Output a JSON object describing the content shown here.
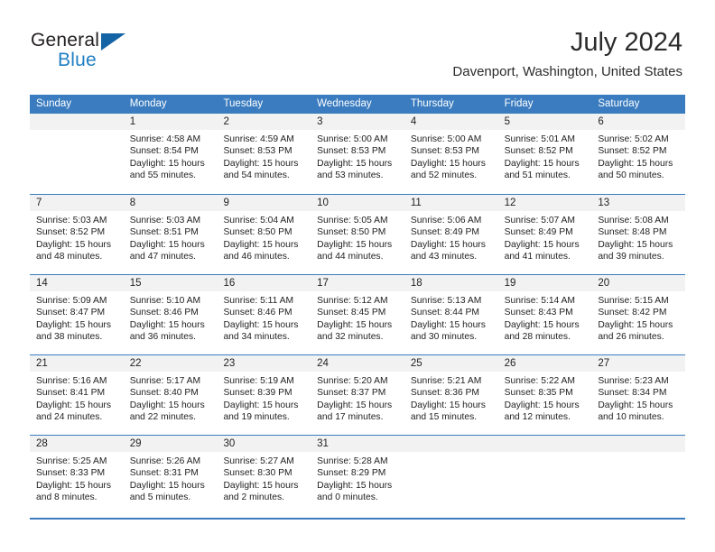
{
  "brand": {
    "name_top": "General",
    "name_bottom": "Blue",
    "triangle_icon": "triangle-icon",
    "color_dark": "#231f20",
    "color_blue": "#1f7fc4"
  },
  "header": {
    "title": "July 2024",
    "subtitle": "Davenport, Washington, United States"
  },
  "theme": {
    "header_blue": "#3a7cbf",
    "date_band_gray": "#f2f2f2",
    "text": "#222222"
  },
  "weekdays": [
    "Sunday",
    "Monday",
    "Tuesday",
    "Wednesday",
    "Thursday",
    "Friday",
    "Saturday"
  ],
  "weeks": [
    [
      {
        "date": "",
        "sunrise": "",
        "sunset": "",
        "daylight_line1": "",
        "daylight_line2": ""
      },
      {
        "date": "1",
        "sunrise": "Sunrise: 4:58 AM",
        "sunset": "Sunset: 8:54 PM",
        "daylight_line1": "Daylight: 15 hours",
        "daylight_line2": "and 55 minutes."
      },
      {
        "date": "2",
        "sunrise": "Sunrise: 4:59 AM",
        "sunset": "Sunset: 8:53 PM",
        "daylight_line1": "Daylight: 15 hours",
        "daylight_line2": "and 54 minutes."
      },
      {
        "date": "3",
        "sunrise": "Sunrise: 5:00 AM",
        "sunset": "Sunset: 8:53 PM",
        "daylight_line1": "Daylight: 15 hours",
        "daylight_line2": "and 53 minutes."
      },
      {
        "date": "4",
        "sunrise": "Sunrise: 5:00 AM",
        "sunset": "Sunset: 8:53 PM",
        "daylight_line1": "Daylight: 15 hours",
        "daylight_line2": "and 52 minutes."
      },
      {
        "date": "5",
        "sunrise": "Sunrise: 5:01 AM",
        "sunset": "Sunset: 8:52 PM",
        "daylight_line1": "Daylight: 15 hours",
        "daylight_line2": "and 51 minutes."
      },
      {
        "date": "6",
        "sunrise": "Sunrise: 5:02 AM",
        "sunset": "Sunset: 8:52 PM",
        "daylight_line1": "Daylight: 15 hours",
        "daylight_line2": "and 50 minutes."
      }
    ],
    [
      {
        "date": "7",
        "sunrise": "Sunrise: 5:03 AM",
        "sunset": "Sunset: 8:52 PM",
        "daylight_line1": "Daylight: 15 hours",
        "daylight_line2": "and 48 minutes."
      },
      {
        "date": "8",
        "sunrise": "Sunrise: 5:03 AM",
        "sunset": "Sunset: 8:51 PM",
        "daylight_line1": "Daylight: 15 hours",
        "daylight_line2": "and 47 minutes."
      },
      {
        "date": "9",
        "sunrise": "Sunrise: 5:04 AM",
        "sunset": "Sunset: 8:50 PM",
        "daylight_line1": "Daylight: 15 hours",
        "daylight_line2": "and 46 minutes."
      },
      {
        "date": "10",
        "sunrise": "Sunrise: 5:05 AM",
        "sunset": "Sunset: 8:50 PM",
        "daylight_line1": "Daylight: 15 hours",
        "daylight_line2": "and 44 minutes."
      },
      {
        "date": "11",
        "sunrise": "Sunrise: 5:06 AM",
        "sunset": "Sunset: 8:49 PM",
        "daylight_line1": "Daylight: 15 hours",
        "daylight_line2": "and 43 minutes."
      },
      {
        "date": "12",
        "sunrise": "Sunrise: 5:07 AM",
        "sunset": "Sunset: 8:49 PM",
        "daylight_line1": "Daylight: 15 hours",
        "daylight_line2": "and 41 minutes."
      },
      {
        "date": "13",
        "sunrise": "Sunrise: 5:08 AM",
        "sunset": "Sunset: 8:48 PM",
        "daylight_line1": "Daylight: 15 hours",
        "daylight_line2": "and 39 minutes."
      }
    ],
    [
      {
        "date": "14",
        "sunrise": "Sunrise: 5:09 AM",
        "sunset": "Sunset: 8:47 PM",
        "daylight_line1": "Daylight: 15 hours",
        "daylight_line2": "and 38 minutes."
      },
      {
        "date": "15",
        "sunrise": "Sunrise: 5:10 AM",
        "sunset": "Sunset: 8:46 PM",
        "daylight_line1": "Daylight: 15 hours",
        "daylight_line2": "and 36 minutes."
      },
      {
        "date": "16",
        "sunrise": "Sunrise: 5:11 AM",
        "sunset": "Sunset: 8:46 PM",
        "daylight_line1": "Daylight: 15 hours",
        "daylight_line2": "and 34 minutes."
      },
      {
        "date": "17",
        "sunrise": "Sunrise: 5:12 AM",
        "sunset": "Sunset: 8:45 PM",
        "daylight_line1": "Daylight: 15 hours",
        "daylight_line2": "and 32 minutes."
      },
      {
        "date": "18",
        "sunrise": "Sunrise: 5:13 AM",
        "sunset": "Sunset: 8:44 PM",
        "daylight_line1": "Daylight: 15 hours",
        "daylight_line2": "and 30 minutes."
      },
      {
        "date": "19",
        "sunrise": "Sunrise: 5:14 AM",
        "sunset": "Sunset: 8:43 PM",
        "daylight_line1": "Daylight: 15 hours",
        "daylight_line2": "and 28 minutes."
      },
      {
        "date": "20",
        "sunrise": "Sunrise: 5:15 AM",
        "sunset": "Sunset: 8:42 PM",
        "daylight_line1": "Daylight: 15 hours",
        "daylight_line2": "and 26 minutes."
      }
    ],
    [
      {
        "date": "21",
        "sunrise": "Sunrise: 5:16 AM",
        "sunset": "Sunset: 8:41 PM",
        "daylight_line1": "Daylight: 15 hours",
        "daylight_line2": "and 24 minutes."
      },
      {
        "date": "22",
        "sunrise": "Sunrise: 5:17 AM",
        "sunset": "Sunset: 8:40 PM",
        "daylight_line1": "Daylight: 15 hours",
        "daylight_line2": "and 22 minutes."
      },
      {
        "date": "23",
        "sunrise": "Sunrise: 5:19 AM",
        "sunset": "Sunset: 8:39 PM",
        "daylight_line1": "Daylight: 15 hours",
        "daylight_line2": "and 19 minutes."
      },
      {
        "date": "24",
        "sunrise": "Sunrise: 5:20 AM",
        "sunset": "Sunset: 8:37 PM",
        "daylight_line1": "Daylight: 15 hours",
        "daylight_line2": "and 17 minutes."
      },
      {
        "date": "25",
        "sunrise": "Sunrise: 5:21 AM",
        "sunset": "Sunset: 8:36 PM",
        "daylight_line1": "Daylight: 15 hours",
        "daylight_line2": "and 15 minutes."
      },
      {
        "date": "26",
        "sunrise": "Sunrise: 5:22 AM",
        "sunset": "Sunset: 8:35 PM",
        "daylight_line1": "Daylight: 15 hours",
        "daylight_line2": "and 12 minutes."
      },
      {
        "date": "27",
        "sunrise": "Sunrise: 5:23 AM",
        "sunset": "Sunset: 8:34 PM",
        "daylight_line1": "Daylight: 15 hours",
        "daylight_line2": "and 10 minutes."
      }
    ],
    [
      {
        "date": "28",
        "sunrise": "Sunrise: 5:25 AM",
        "sunset": "Sunset: 8:33 PM",
        "daylight_line1": "Daylight: 15 hours",
        "daylight_line2": "and 8 minutes."
      },
      {
        "date": "29",
        "sunrise": "Sunrise: 5:26 AM",
        "sunset": "Sunset: 8:31 PM",
        "daylight_line1": "Daylight: 15 hours",
        "daylight_line2": "and 5 minutes."
      },
      {
        "date": "30",
        "sunrise": "Sunrise: 5:27 AM",
        "sunset": "Sunset: 8:30 PM",
        "daylight_line1": "Daylight: 15 hours",
        "daylight_line2": "and 2 minutes."
      },
      {
        "date": "31",
        "sunrise": "Sunrise: 5:28 AM",
        "sunset": "Sunset: 8:29 PM",
        "daylight_line1": "Daylight: 15 hours",
        "daylight_line2": "and 0 minutes."
      },
      {
        "date": "",
        "sunrise": "",
        "sunset": "",
        "daylight_line1": "",
        "daylight_line2": ""
      },
      {
        "date": "",
        "sunrise": "",
        "sunset": "",
        "daylight_line1": "",
        "daylight_line2": ""
      },
      {
        "date": "",
        "sunrise": "",
        "sunset": "",
        "daylight_line1": "",
        "daylight_line2": ""
      }
    ]
  ]
}
